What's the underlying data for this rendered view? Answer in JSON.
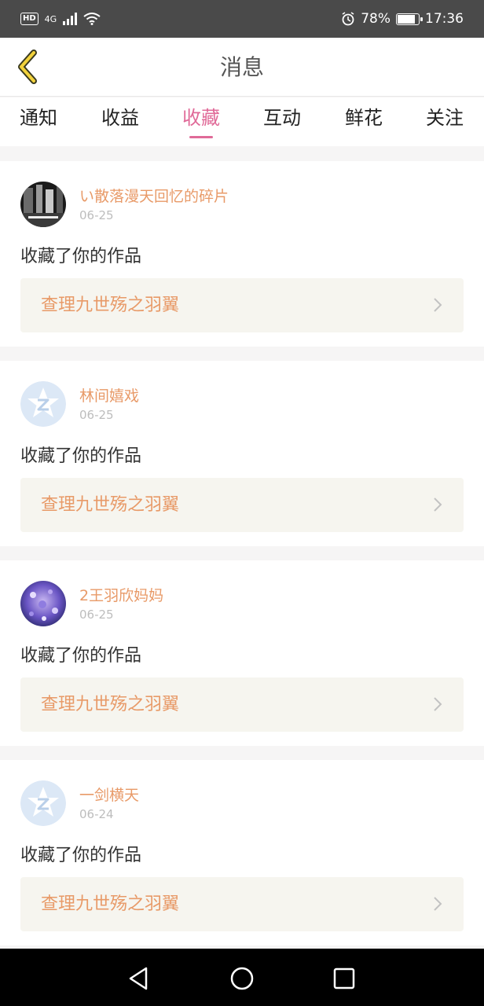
{
  "status": {
    "hd": "HD",
    "network": "4G",
    "battery_text": "78%",
    "battery_level": 0.78,
    "time": "17:36"
  },
  "header": {
    "title": "消息",
    "back_icon": "chevron-left-icon"
  },
  "tabs": [
    {
      "label": "通知",
      "active": false
    },
    {
      "label": "收益",
      "active": false
    },
    {
      "label": "收藏",
      "active": true
    },
    {
      "label": "互动",
      "active": false
    },
    {
      "label": "鲜花",
      "active": false
    },
    {
      "label": "关注",
      "active": false
    }
  ],
  "colors": {
    "accent": "#e06a98",
    "username": "#e89a68",
    "work_bg": "#f6f5ef"
  },
  "items": [
    {
      "user": "い散落漫天回忆的碎片",
      "date": "06-25",
      "action": "收藏了你的作品",
      "work": "查理九世殇之羽翼",
      "avatar": "photo-avatar-dark"
    },
    {
      "user": "林间嬉戏",
      "date": "06-25",
      "action": "收藏了你的作品",
      "work": "查理九世殇之羽翼",
      "avatar": "default-star-avatar"
    },
    {
      "user": "2王羽欣妈妈",
      "date": "06-25",
      "action": "收藏了你的作品",
      "work": "查理九世殇之羽翼",
      "avatar": "photo-avatar-purple"
    },
    {
      "user": "一剑横天",
      "date": "06-24",
      "action": "收藏了你的作品",
      "work": "查理九世殇之羽翼",
      "avatar": "default-star-avatar"
    }
  ],
  "navbar": {
    "back": "triangle-back-icon",
    "home": "circle-home-icon",
    "recents": "square-recents-icon"
  }
}
